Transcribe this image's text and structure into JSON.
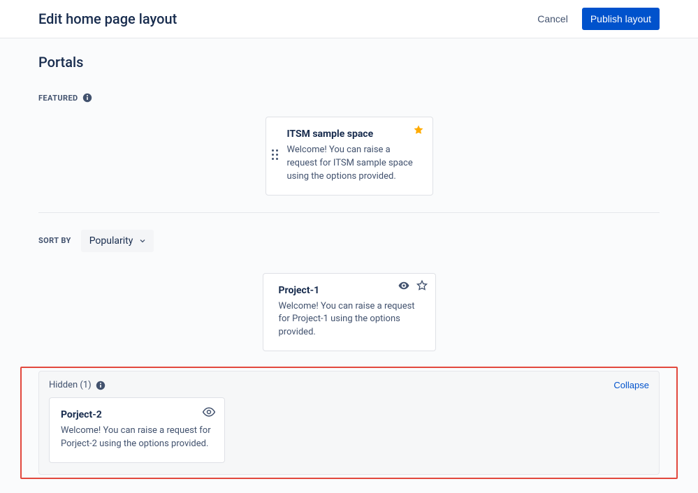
{
  "header": {
    "title": "Edit home page layout",
    "cancel_label": "Cancel",
    "publish_label": "Publish layout"
  },
  "page": {
    "heading": "Portals"
  },
  "featured": {
    "label": "FEATURED",
    "card": {
      "title": "ITSM sample space",
      "description": "Welcome! You can raise a request for ITSM sample space using the options provided."
    }
  },
  "sort": {
    "label": "SORT BY",
    "selected": "Popularity"
  },
  "visible_card": {
    "title": "Project-1",
    "description": "Welcome! You can raise a request for Project-1 using the options provided."
  },
  "hidden": {
    "label": "Hidden (1)",
    "collapse_label": "Collapse",
    "card": {
      "title": "Porject-2",
      "description": "Welcome! You can raise a request for Porject-2 using the options provided."
    }
  }
}
